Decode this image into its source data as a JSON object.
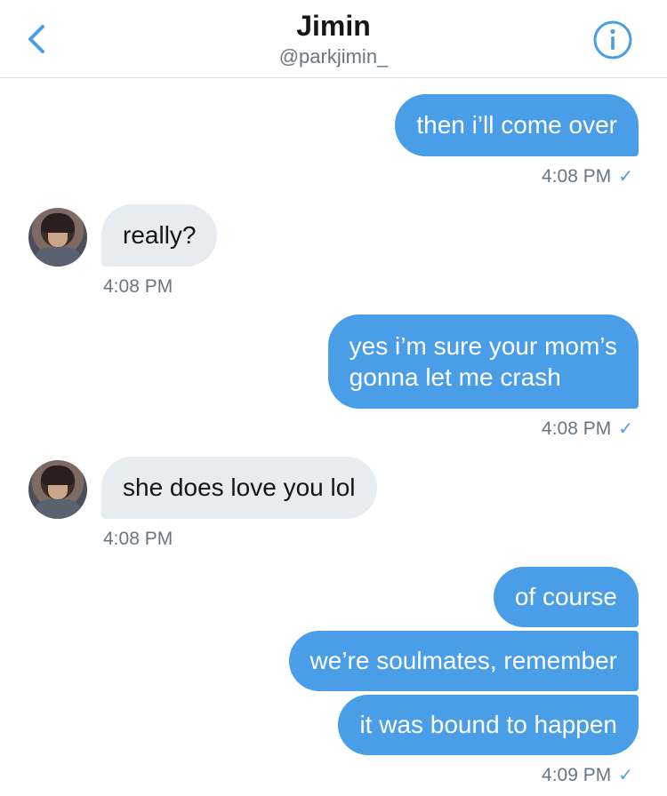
{
  "header": {
    "title": "Jimin",
    "handle": "@parkjimin_",
    "back_icon": "chevron-left-icon",
    "info_icon": "info-icon",
    "accent_color": "#4a9de7"
  },
  "messages": [
    {
      "direction": "outgoing",
      "text": "then i’ll come over",
      "time": "4:08 PM",
      "check": "✓"
    },
    {
      "direction": "incoming",
      "text": "really?",
      "time": "4:08 PM"
    },
    {
      "direction": "outgoing",
      "lines": [
        "yes i’m sure your mom’s",
        "gonna let me crash"
      ],
      "time": "4:08 PM",
      "check": "✓"
    },
    {
      "direction": "incoming",
      "text": "she does love you lol",
      "time": "4:08 PM"
    },
    {
      "direction": "outgoing",
      "text": "of course"
    },
    {
      "direction": "outgoing",
      "text": "we’re soulmates, remember"
    },
    {
      "direction": "outgoing",
      "text": "it was bound to happen",
      "time": "4:09 PM",
      "check": "✓"
    }
  ],
  "colors": {
    "outgoing_bubble": "#4a9de7",
    "incoming_bubble": "#e6ecf0",
    "timestamp": "#657786"
  }
}
